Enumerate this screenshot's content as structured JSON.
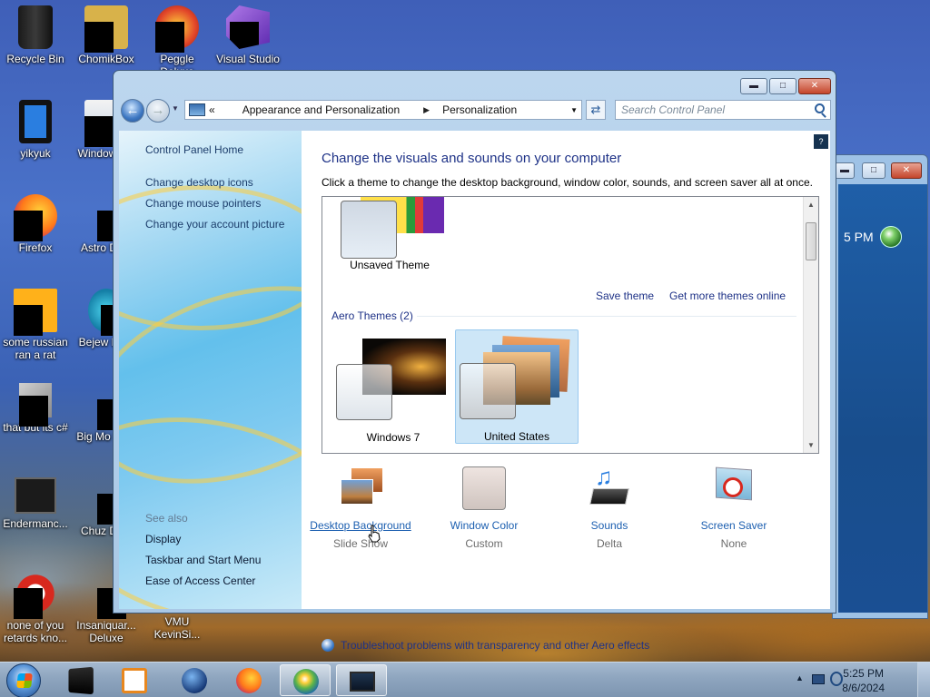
{
  "desktop": {
    "icons": [
      {
        "label": "Recycle Bin"
      },
      {
        "label": "ChomikBox"
      },
      {
        "label": "Peggle Deluxe"
      },
      {
        "label": "Visual Studio"
      },
      {
        "label": "yikyuk"
      },
      {
        "label": "Window Ma"
      },
      {
        "label": "Firefox"
      },
      {
        "label": "Astro Delu"
      },
      {
        "label": "some russian ran a rat"
      },
      {
        "label": "Bejew Delu"
      },
      {
        "label": "that but its c#"
      },
      {
        "label": "Big Mo Delu"
      },
      {
        "label": "Endermanc..."
      },
      {
        "label": "Chuz Delu"
      },
      {
        "label": "none of you retards kno..."
      },
      {
        "label": "Insaniquar... Deluxe"
      },
      {
        "label": "VMU KevinSi..."
      }
    ]
  },
  "back_window": {
    "time_fragment": "5 PM"
  },
  "window": {
    "controls": {
      "minimize": "▬",
      "maximize": "□",
      "close": "✕"
    },
    "address": {
      "root_glyph": "«",
      "segments": [
        "Appearance and Personalization",
        "Personalization"
      ]
    },
    "search": {
      "placeholder": "Search Control Panel"
    },
    "left_pane": {
      "home": "Control Panel Home",
      "links": [
        "Change desktop icons",
        "Change mouse pointers",
        "Change your account picture"
      ],
      "see_also": "See also",
      "see_also_links": [
        "Display",
        "Taskbar and Start Menu",
        "Ease of Access Center"
      ]
    },
    "content": {
      "title": "Change the visuals and sounds on your computer",
      "subtitle": "Click a theme to change the desktop background, window color, sounds, and screen saver all at once.",
      "themes": {
        "unsaved": "Unsaved Theme",
        "save_theme": "Save theme",
        "get_more": "Get more themes online",
        "group_header": "Aero Themes (2)",
        "aero": [
          {
            "name": "Windows 7",
            "selected": false
          },
          {
            "name": "United States",
            "selected": true
          }
        ]
      },
      "tools": [
        {
          "name": "Desktop Background",
          "value": "Slide Show",
          "icon": "desktop-background-icon"
        },
        {
          "name": "Window Color",
          "value": "Custom",
          "icon": "window-color-icon"
        },
        {
          "name": "Sounds",
          "value": "Delta",
          "icon": "sounds-icon"
        },
        {
          "name": "Screen Saver",
          "value": "None",
          "icon": "screen-saver-icon"
        }
      ],
      "troubleshoot": "Troubleshoot problems with transparency and other Aero effects"
    }
  },
  "taskbar": {
    "time": "5:25 PM",
    "date": "8/6/2024",
    "items": [
      "terminal-icon",
      "media-player-icon",
      "globe-icon",
      "firefox-icon",
      "windows-orb-icon",
      "display-window-icon"
    ]
  },
  "colors": {
    "link": "#1e3287",
    "accent": "#1c5fb0"
  }
}
